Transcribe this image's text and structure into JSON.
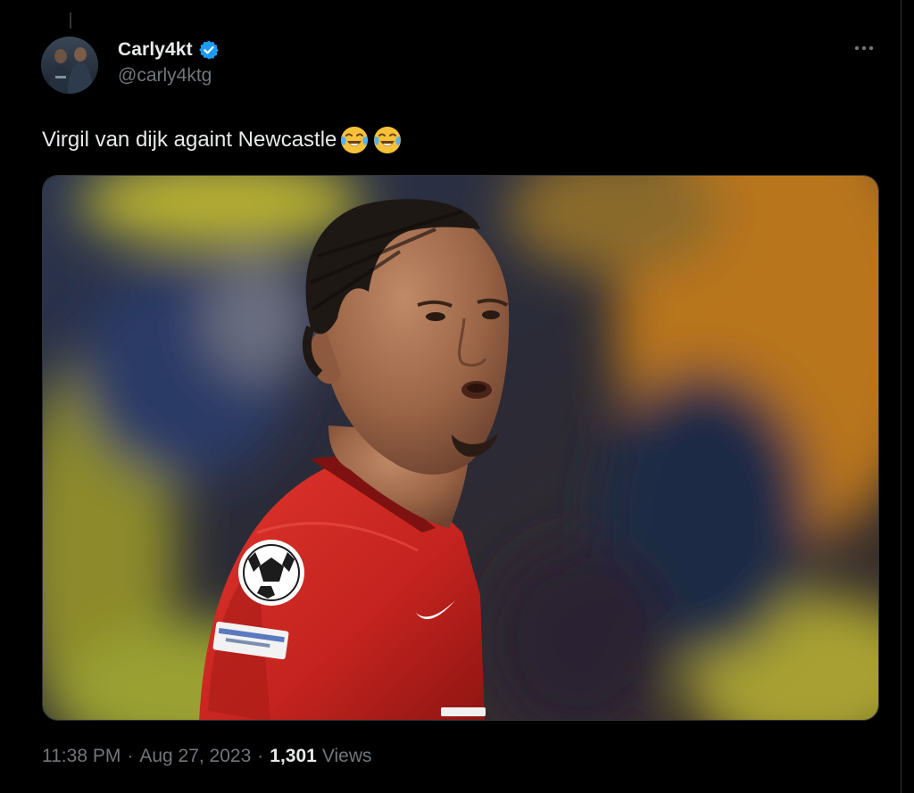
{
  "tweet": {
    "author": {
      "display_name": "Carly4kt",
      "handle": "@carly4ktg",
      "verified": true,
      "avatar_icon": "profile-photo-icon",
      "verified_icon": "verified-badge-icon"
    },
    "text": "Virgil van dijk againt Newcastle",
    "emojis": [
      "face-with-tears-of-joy",
      "face-with-tears-of-joy"
    ],
    "media": {
      "type": "photo",
      "icon": "photo-footballer-red-kit"
    },
    "time": "11:38 PM",
    "separator": "·",
    "date": "Aug 27, 2023",
    "views_count": "1,301",
    "views_label": "Views"
  },
  "colors": {
    "background": "#000000",
    "text_primary": "#e7e9ea",
    "text_secondary": "#71767b",
    "verified_blue": "#1d9bf0",
    "border": "#2f3336"
  }
}
